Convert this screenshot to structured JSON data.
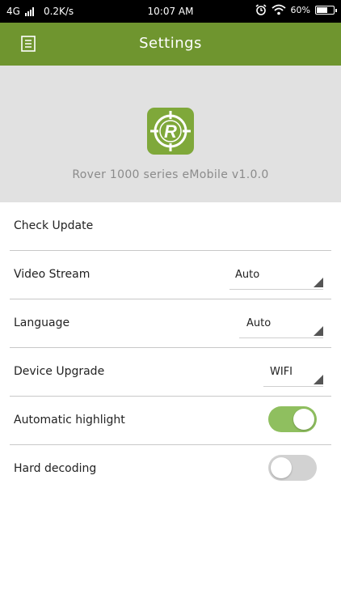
{
  "status_bar": {
    "network": "4G",
    "speed": "0.2K/s",
    "time": "10:07 AM",
    "battery": "60%",
    "battery_level": 0.6
  },
  "app_bar": {
    "title": "Settings",
    "menu_icon": "document-menu-icon",
    "color": "#6f952f"
  },
  "hero": {
    "logo_letter": "R",
    "logo_color": "#7fa83a",
    "caption": "Rover 1000 series eMobile v1.0.0"
  },
  "settings": {
    "check_update": {
      "label": "Check Update"
    },
    "video_stream": {
      "label": "Video Stream",
      "value": "Auto"
    },
    "language": {
      "label": "Language",
      "value": "Auto"
    },
    "device_upgrade": {
      "label": "Device Upgrade",
      "value": "WIFI"
    },
    "automatic_highlight": {
      "label": "Automatic highlight",
      "enabled": true
    },
    "hard_decoding": {
      "label": "Hard decoding",
      "enabled": false
    }
  }
}
